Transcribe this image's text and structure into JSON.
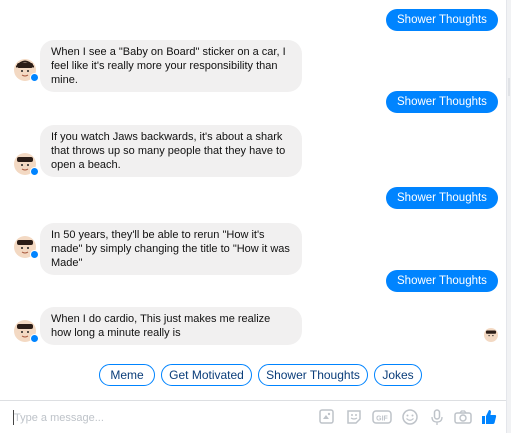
{
  "messages": [
    {
      "from": "user",
      "text": "Shower Thoughts"
    },
    {
      "from": "bot",
      "text": "When I see a \"Baby on Board\" sticker on a car, I feel like it's really more your responsibility than mine."
    },
    {
      "from": "user",
      "text": "Shower Thoughts"
    },
    {
      "from": "bot",
      "text": "If you watch Jaws backwards, it's about a shark that throws up so many people that they have to open a beach."
    },
    {
      "from": "user",
      "text": "Shower Thoughts"
    },
    {
      "from": "bot",
      "text": "In 50 years, they'll be able to rerun \"How it's made\" by simply changing the title to \"How it was Made\""
    },
    {
      "from": "user",
      "text": "Shower Thoughts"
    },
    {
      "from": "bot",
      "text": "When I do cardio, This just makes me realize how long a minute really is"
    }
  ],
  "quick_replies": [
    "Meme",
    "Get Motivated",
    "Shower Thoughts",
    "Jokes"
  ],
  "composer": {
    "placeholder": "Type a message...",
    "tools": [
      "sticker-icon",
      "emoji-sticker-icon",
      "gif-icon",
      "emoji-icon",
      "microphone-icon",
      "camera-icon",
      "thumbs-up-icon"
    ]
  },
  "colors": {
    "accent": "#0084ff",
    "bot_bubble": "#f1f0f0",
    "tool_gray": "#bec3c9"
  }
}
